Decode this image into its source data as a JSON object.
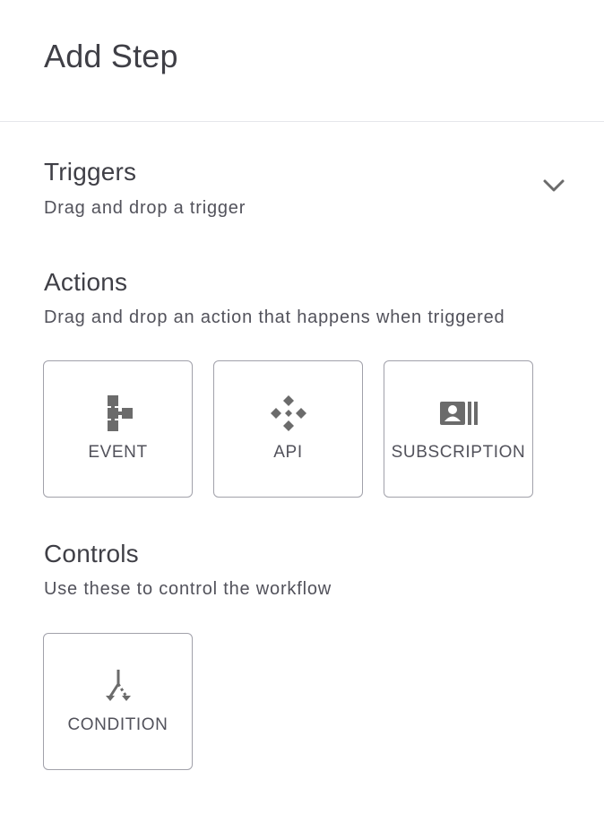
{
  "header": {
    "title": "Add Step"
  },
  "triggers": {
    "title": "Triggers",
    "description": "Drag and drop a trigger",
    "expand_icon": "chevron-down-icon"
  },
  "actions": {
    "title": "Actions",
    "description": "Drag and drop an action that happens when triggered",
    "items": [
      {
        "label": "EVENT",
        "icon": "event-flow-icon"
      },
      {
        "label": "API",
        "icon": "api-icon"
      },
      {
        "label": "SUBSCRIPTION",
        "icon": "subscription-icon"
      }
    ]
  },
  "controls": {
    "title": "Controls",
    "description": "Use these to control the workflow",
    "items": [
      {
        "label": "CONDITION",
        "icon": "condition-split-icon"
      }
    ]
  },
  "colors": {
    "text": "#3f3f46",
    "icon": "#6b6b6b",
    "tile_border": "#a1a1aa",
    "divider": "#e5e7eb"
  }
}
